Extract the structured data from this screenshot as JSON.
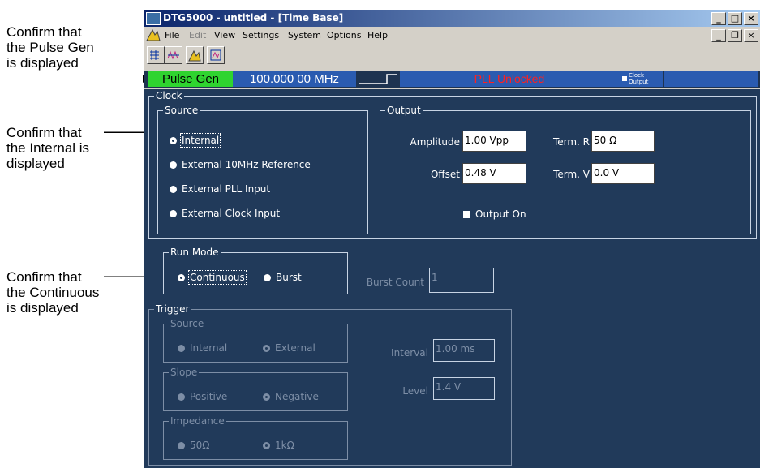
{
  "callouts": {
    "pulse_gen": [
      "Confirm that",
      "the Pulse Gen",
      "is displayed"
    ],
    "internal": [
      "Confirm that",
      "the Internal is",
      "displayed"
    ],
    "continuous": [
      "Confirm that",
      "the Continuous",
      "is displayed"
    ]
  },
  "window": {
    "title": "DTG5000 - untitled - [Time Base]",
    "controls": {
      "minimize": "_",
      "maximize": "□",
      "close": "×"
    },
    "doc_controls": {
      "minimize": "_",
      "restore": "❐",
      "close": "×"
    }
  },
  "menu": {
    "items": [
      {
        "label": "File",
        "disabled": false
      },
      {
        "label": "Edit",
        "disabled": true
      },
      {
        "label": "View",
        "disabled": false
      },
      {
        "label": "Settings",
        "disabled": false
      },
      {
        "label": "System",
        "disabled": false
      },
      {
        "label": "Options",
        "disabled": false
      },
      {
        "label": "Help",
        "disabled": false
      }
    ]
  },
  "status": {
    "mode": "Pulse Gen",
    "frequency": "100.000 00 MHz",
    "pll": "PLL Unlocked",
    "clock_output": "Clock Output",
    "colors": {
      "mode_bg": "#2fd42f",
      "pll_text": "#ff2020",
      "cell_bg": "#2a5bb0"
    }
  },
  "clock": {
    "label": "Clock",
    "source": {
      "label": "Source",
      "options": [
        "Internal",
        "External 10MHz Reference",
        "External PLL Input",
        "External Clock Input"
      ],
      "selected": "Internal"
    },
    "output": {
      "label": "Output",
      "amplitude_label": "Amplitude",
      "amplitude": "1.00 Vpp",
      "offset_label": "Offset",
      "offset": "0.48 V",
      "term_r_label": "Term. R",
      "term_r": "50 Ω",
      "term_v_label": "Term. V",
      "term_v": "0.0 V",
      "output_on": "Output On"
    }
  },
  "run_mode": {
    "label": "Run Mode",
    "options": [
      "Continuous",
      "Burst"
    ],
    "selected": "Continuous",
    "burst_count_label": "Burst Count",
    "burst_count": "1"
  },
  "trigger": {
    "label": "Trigger",
    "source": {
      "label": "Source",
      "options": [
        "Internal",
        "External"
      ],
      "selected": "External"
    },
    "slope": {
      "label": "Slope",
      "options": [
        "Positive",
        "Negative"
      ],
      "selected": "Negative"
    },
    "impedance": {
      "label": "Impedance",
      "options": [
        "50Ω",
        "1kΩ"
      ],
      "selected": "1kΩ"
    },
    "interval_label": "Interval",
    "interval": "1.00 ms",
    "level_label": "Level",
    "level": "1.4 V"
  }
}
